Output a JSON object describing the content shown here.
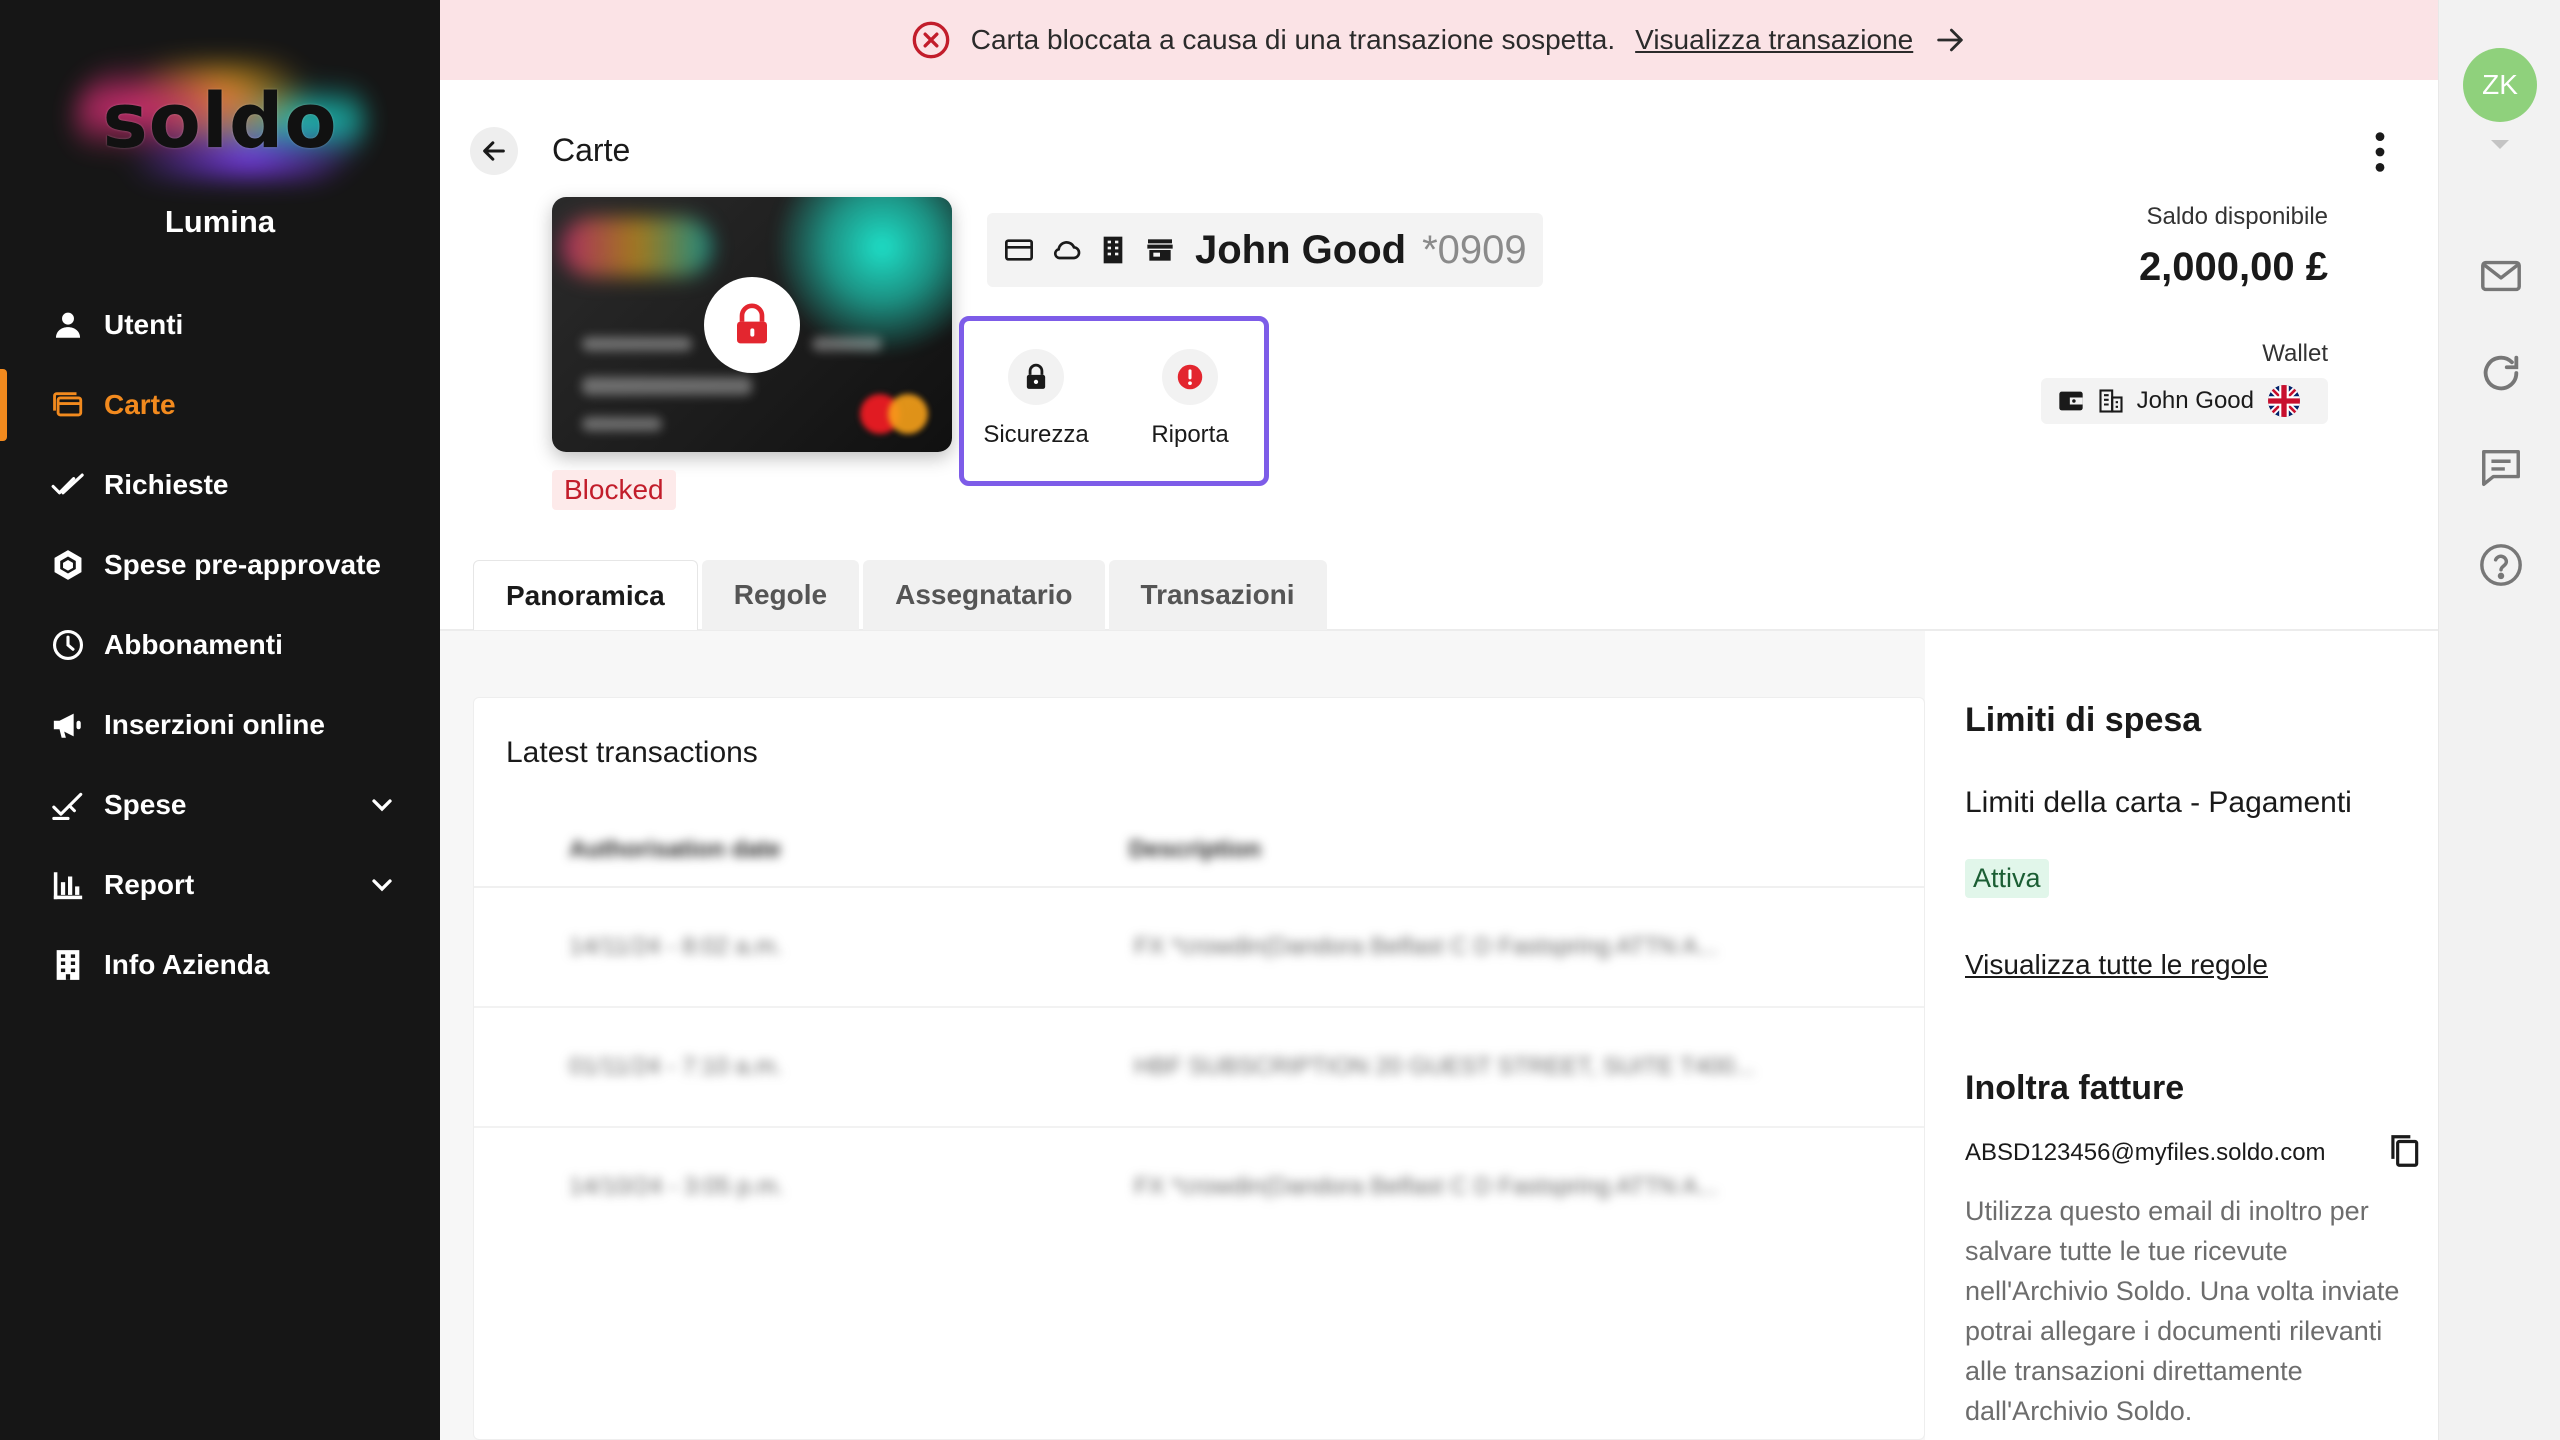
{
  "brand": {
    "logo_text": "soldo",
    "org_name": "Lumina",
    "accent": "#f28a1e"
  },
  "sidebar": {
    "items": [
      {
        "label": "Utenti",
        "icon": "user-icon",
        "active": false,
        "expandable": false
      },
      {
        "label": "Carte",
        "icon": "cards-icon",
        "active": true,
        "expandable": false
      },
      {
        "label": "Richieste",
        "icon": "double-check-icon",
        "active": false,
        "expandable": false
      },
      {
        "label": "Spese pre-approvate",
        "icon": "hexagon-check-icon",
        "active": false,
        "expandable": false
      },
      {
        "label": "Abbonamenti",
        "icon": "clock-icon",
        "active": false,
        "expandable": false
      },
      {
        "label": "Inserzioni online",
        "icon": "megaphone-icon",
        "active": false,
        "expandable": false
      },
      {
        "label": "Spese",
        "icon": "check-pen-icon",
        "active": false,
        "expandable": true
      },
      {
        "label": "Report",
        "icon": "bar-chart-icon",
        "active": false,
        "expandable": true
      },
      {
        "label": "Info Azienda",
        "icon": "building-icon",
        "active": false,
        "expandable": false
      }
    ]
  },
  "banner": {
    "message": "Carta bloccata a causa di una transazione sospetta.",
    "link": "Visualizza transazione",
    "color": "#fbe3e6",
    "icon": "x-circle-icon"
  },
  "header": {
    "title": "Carte"
  },
  "card": {
    "holder": "John Good",
    "last4": "*0909",
    "status": "Blocked",
    "status_color": "#c21d2b"
  },
  "actions": {
    "security": "Sicurezza",
    "report": "Riporta"
  },
  "balance": {
    "label": "Saldo disponibile",
    "value": "2,000,00 £"
  },
  "wallet": {
    "label": "Wallet",
    "name": "John Good",
    "flag": "uk-flag-icon"
  },
  "tabs": [
    "Panoramica",
    "Regole",
    "Assegnatario",
    "Transazioni"
  ],
  "transactions": {
    "title": "Latest transactions",
    "columns": [
      "Authorisation date",
      "Description"
    ],
    "rows": [
      {
        "date": "14/11/24 - 8:02 a.m.",
        "description": "FX *crowdin(Dandora Belfast C D Fastspring ATTN A..."
      },
      {
        "date": "01/11/24 - 7:10 a.m.",
        "description": "HBF SUBSCRIPTION 20 GUEST STREET, SUITE T400..."
      },
      {
        "date": "14/10/24 - 3:05 p.m.",
        "description": "FX *crowdin(Dandora Belfast C D Fastspring ATTN A..."
      }
    ]
  },
  "limits": {
    "title": "Limiti di spesa",
    "subtitle": "Limiti della carta - Pagamenti",
    "status": "Attiva",
    "link": "Visualizza tutte le regole"
  },
  "invoices": {
    "title": "Inoltra fatture",
    "email": "ABSD123456@myfiles.soldo.com",
    "description": "Utilizza questo email di inoltro per salvare tutte le tue ricevute nell'Archivio Soldo. Una volta inviate potrai allegare i documenti rilevanti alle transazioni direttamente dall'Archivio Soldo."
  },
  "user": {
    "initials": "ZK",
    "avatar_color": "#8fd17c"
  },
  "rail": {
    "icons": [
      "mail-icon",
      "refresh-icon",
      "chat-icon",
      "help-icon"
    ]
  }
}
